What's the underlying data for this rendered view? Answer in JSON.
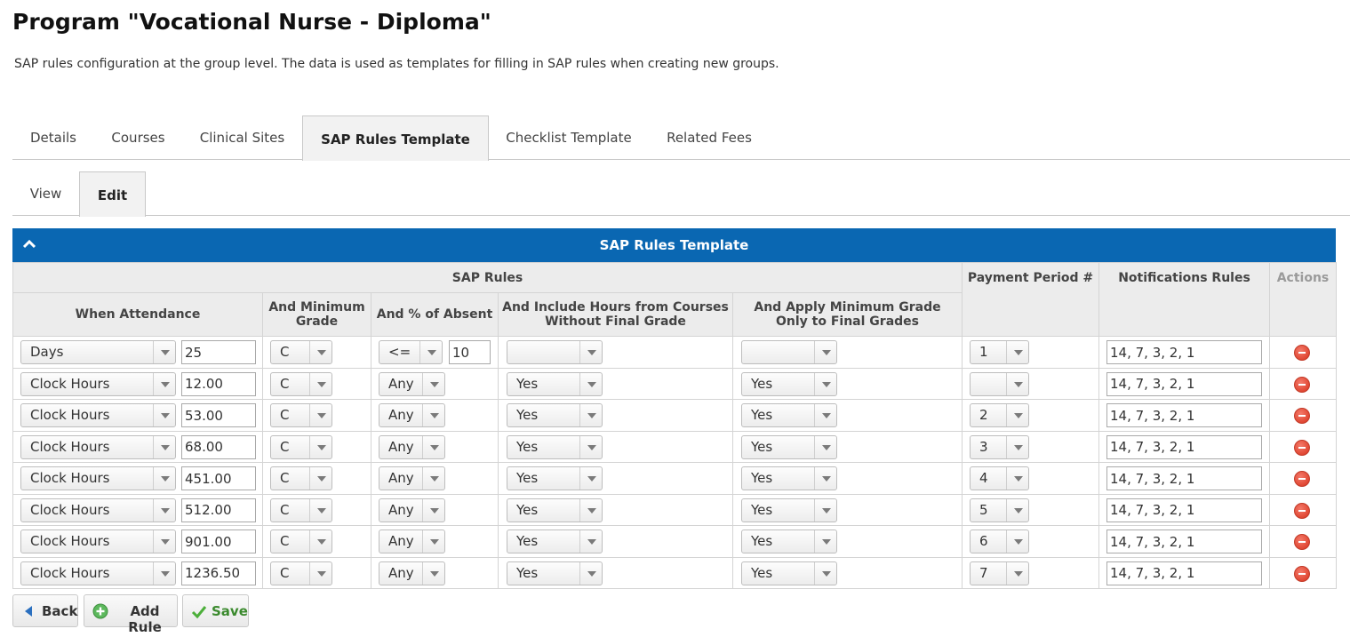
{
  "page": {
    "title": "Program \"Vocational Nurse - Diploma\"",
    "description": "SAP rules configuration at the group level. The data is used as templates for filling in SAP rules when creating new groups."
  },
  "tabs": [
    {
      "label": "Details"
    },
    {
      "label": "Courses"
    },
    {
      "label": "Clinical Sites"
    },
    {
      "label": "SAP Rules Template",
      "active": true
    },
    {
      "label": "Checklist Template"
    },
    {
      "label": "Related Fees"
    }
  ],
  "subtabs": [
    {
      "label": "View"
    },
    {
      "label": "Edit",
      "active": true
    }
  ],
  "grid": {
    "title": "SAP Rules Template",
    "header_color": "#0a67b2",
    "group_header": "SAP Rules",
    "columns": {
      "when_attendance": "When Attendance",
      "min_grade": "And Minimum Grade",
      "pct_absent": "And % of Absent",
      "include_hours": "And Include Hours from Courses Without Final Grade",
      "apply_min_grade": "And Apply Minimum Grade Only to Final Grades",
      "payment_period": "Payment Period #",
      "notifications": "Notifications Rules",
      "actions": "Actions"
    },
    "rows": [
      {
        "attendance_type": "Days",
        "attendance_value": "25",
        "min_grade": "C",
        "absent_op": "<=",
        "absent_value": "10",
        "include_hours": "",
        "apply_min_grade": "",
        "payment_period": "1",
        "notifications": "14, 7, 3, 2, 1"
      },
      {
        "attendance_type": "Clock Hours",
        "attendance_value": "12.00",
        "min_grade": "C",
        "absent_op": "Any",
        "absent_value": null,
        "include_hours": "Yes",
        "apply_min_grade": "Yes",
        "payment_period": "",
        "notifications": "14, 7, 3, 2, 1"
      },
      {
        "attendance_type": "Clock Hours",
        "attendance_value": "53.00",
        "min_grade": "C",
        "absent_op": "Any",
        "absent_value": null,
        "include_hours": "Yes",
        "apply_min_grade": "Yes",
        "payment_period": "2",
        "notifications": "14, 7, 3, 2, 1"
      },
      {
        "attendance_type": "Clock Hours",
        "attendance_value": "68.00",
        "min_grade": "C",
        "absent_op": "Any",
        "absent_value": null,
        "include_hours": "Yes",
        "apply_min_grade": "Yes",
        "payment_period": "3",
        "notifications": "14, 7, 3, 2, 1"
      },
      {
        "attendance_type": "Clock Hours",
        "attendance_value": "451.00",
        "min_grade": "C",
        "absent_op": "Any",
        "absent_value": null,
        "include_hours": "Yes",
        "apply_min_grade": "Yes",
        "payment_period": "4",
        "notifications": "14, 7, 3, 2, 1"
      },
      {
        "attendance_type": "Clock Hours",
        "attendance_value": "512.00",
        "min_grade": "C",
        "absent_op": "Any",
        "absent_value": null,
        "include_hours": "Yes",
        "apply_min_grade": "Yes",
        "payment_period": "5",
        "notifications": "14, 7, 3, 2, 1"
      },
      {
        "attendance_type": "Clock Hours",
        "attendance_value": "901.00",
        "min_grade": "C",
        "absent_op": "Any",
        "absent_value": null,
        "include_hours": "Yes",
        "apply_min_grade": "Yes",
        "payment_period": "6",
        "notifications": "14, 7, 3, 2, 1"
      },
      {
        "attendance_type": "Clock Hours",
        "attendance_value": "1236.50",
        "min_grade": "C",
        "absent_op": "Any",
        "absent_value": null,
        "include_hours": "Yes",
        "apply_min_grade": "Yes",
        "payment_period": "7",
        "notifications": "14, 7, 3, 2, 1"
      }
    ]
  },
  "buttons": {
    "back": "Back",
    "add_rule": "Add Rule",
    "save": "Save"
  }
}
